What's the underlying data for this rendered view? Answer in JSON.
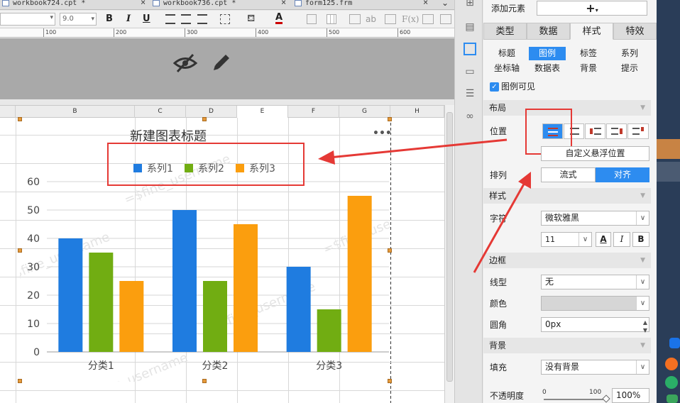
{
  "tabs": [
    {
      "label": "workbook724.cpt *",
      "close": "×"
    },
    {
      "label": "workbook736.cpt *",
      "close": "×"
    },
    {
      "label": "form125.frm",
      "close": "×"
    }
  ],
  "tabs_more": "⌄",
  "toolbar": {
    "font_size": "9.0",
    "bold": "B",
    "italic": "I",
    "underline": "U",
    "font_color": "A",
    "ab": "ab",
    "fx": "F(x)"
  },
  "ruler": [
    "100",
    "200",
    "300",
    "400",
    "500",
    "600"
  ],
  "columns": [
    "B",
    "C",
    "D",
    "E",
    "F",
    "G",
    "H"
  ],
  "chart_data": {
    "type": "bar",
    "title": "新建图表标题",
    "categories": [
      "分类1",
      "分类2",
      "分类3"
    ],
    "series": [
      {
        "name": "系列1",
        "color": "#1f7ce0",
        "values": [
          40,
          50,
          30
        ]
      },
      {
        "name": "系列2",
        "color": "#71ad12",
        "values": [
          35,
          25,
          15
        ]
      },
      {
        "name": "系列3",
        "color": "#fb9e0e",
        "values": [
          25,
          45,
          55
        ]
      }
    ],
    "ylim": [
      0,
      60
    ],
    "yticks": [
      "0",
      "10",
      "20",
      "30",
      "40",
      "50",
      "60"
    ],
    "grid": true,
    "legend": "top"
  },
  "chart_menu": "•••",
  "watermark": "=$fine_username",
  "panel": {
    "add_element": "添加元素",
    "add_symbol": "+",
    "main_tabs": [
      "类型",
      "数据",
      "样式",
      "特效"
    ],
    "sub_tabs_row1": [
      "标题",
      "图例",
      "标签",
      "系列"
    ],
    "sub_tabs_row2": [
      "坐标轴",
      "数据表",
      "背景",
      "提示"
    ],
    "legend_visible": "图例可见",
    "sec_layout": "布局",
    "position_label": "位置",
    "custom_float": "自定义悬浮位置",
    "arrange_label": "排列",
    "arrange_flow": "流式",
    "arrange_align": "对齐",
    "sec_style": "样式",
    "char_label": "字符",
    "font_name": "微软雅黑",
    "font_size": "11",
    "sec_border": "边框",
    "line_type_label": "线型",
    "line_type_value": "无",
    "color_label": "颜色",
    "radius_label": "圆角",
    "radius_value": "0px",
    "sec_background": "背景",
    "fill_label": "填充",
    "fill_value": "没有背景",
    "opacity_label": "不透明度",
    "opacity_min": "0",
    "opacity_max": "100",
    "opacity_value": "100%",
    "opacity_level": 1.0
  },
  "colors": {
    "accent_blue": "#2d8cf0",
    "highlight_red": "#e53935"
  }
}
